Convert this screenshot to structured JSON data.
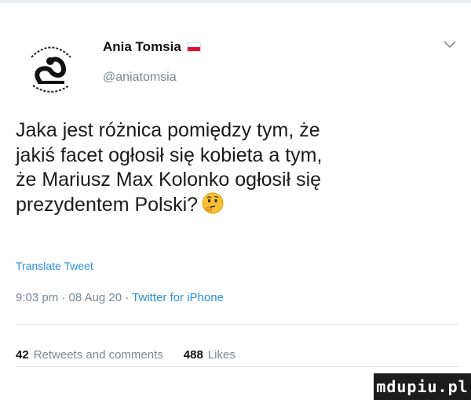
{
  "author": {
    "display_name": "Ania Tomsia",
    "handle": "@aniatomsia",
    "flag_icon": "poland-flag-icon",
    "avatar_icon": "snake-emblem-avatar"
  },
  "tweet": {
    "lines": [
      "Jaka jest różnica pomiędzy tym, że",
      "jakiś facet ogłosił się kobieta a tym,",
      "że Mariusz Max Kolonko ogłosił się",
      "prezydentem Polski?"
    ],
    "emoji": "thinking-face-icon",
    "translate_label": "Translate Tweet"
  },
  "meta": {
    "timestamp": "9:03 pm · 08 Aug 20 · ",
    "source": "Twitter for iPhone"
  },
  "stats": {
    "retweets_count": "42",
    "retweets_label": "Retweets and comments",
    "likes_count": "488",
    "likes_label": "Likes"
  },
  "watermark": {
    "text": "mdupiu.pl"
  },
  "colors": {
    "link": "#2a8fd9",
    "muted": "#7a8690",
    "text": "#1a1a1a"
  }
}
